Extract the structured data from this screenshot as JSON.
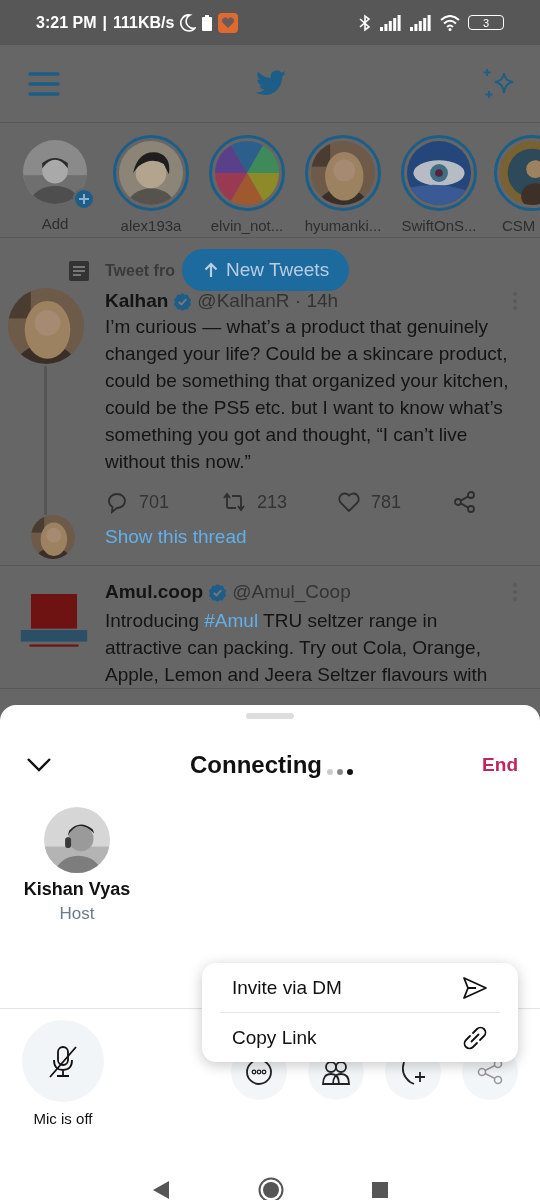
{
  "status_bar": {
    "time": "3:21 PM",
    "separator": "|",
    "speed": "111KB/s",
    "battery": "3"
  },
  "stories": [
    {
      "label": "Add",
      "kind": "add"
    },
    {
      "label": "alex193a",
      "kind": "story"
    },
    {
      "label": "elvin_not...",
      "kind": "story"
    },
    {
      "label": "hyumanki...",
      "kind": "story"
    },
    {
      "label": "SwiftOnS...",
      "kind": "story"
    },
    {
      "label": "CSM",
      "kind": "story"
    }
  ],
  "new_tweets_button": {
    "label": "New Tweets"
  },
  "tweets": [
    {
      "context": "Tweet fro",
      "name": "Kalhan",
      "verified": true,
      "handle": "@KalhanR · 14h",
      "text": [
        {
          "text": "I’m curious — what’s a product that genuinely changed your life? Could be a skincare product, could be something that organized your kitchen, could be the PS5 etc. but I want to know what’s something you got and thought, “I can’t live without this now.”",
          "kind": "plain"
        }
      ],
      "replies": "701",
      "retweets": "213",
      "likes": "781",
      "thread_link": "Show this thread"
    },
    {
      "name": "Amul.coop",
      "verified": true,
      "handle": "@Amul_Coop",
      "text": [
        {
          "text": "Introducing ",
          "kind": "plain"
        },
        {
          "text": "#Amul",
          "kind": "hashtag"
        },
        {
          "text": " TRU seltzer range in attractive can packing. Try out Cola, Orange, Apple, Lemon and Jeera Seltzer flavours with",
          "kind": "plain"
        }
      ]
    }
  ],
  "sheet": {
    "title": "Connecting",
    "end_label": "End",
    "host": {
      "name": "Kishan Vyas",
      "role": "Host"
    },
    "mic": {
      "label": "Mic is off",
      "muted": true
    },
    "actions": [
      {
        "kind": "more"
      },
      {
        "kind": "people"
      },
      {
        "kind": "add-speaker"
      },
      {
        "kind": "share"
      }
    ],
    "menu": [
      {
        "label": "Invite via DM",
        "kind": "dm"
      },
      {
        "label": "Copy Link",
        "kind": "link"
      }
    ]
  }
}
